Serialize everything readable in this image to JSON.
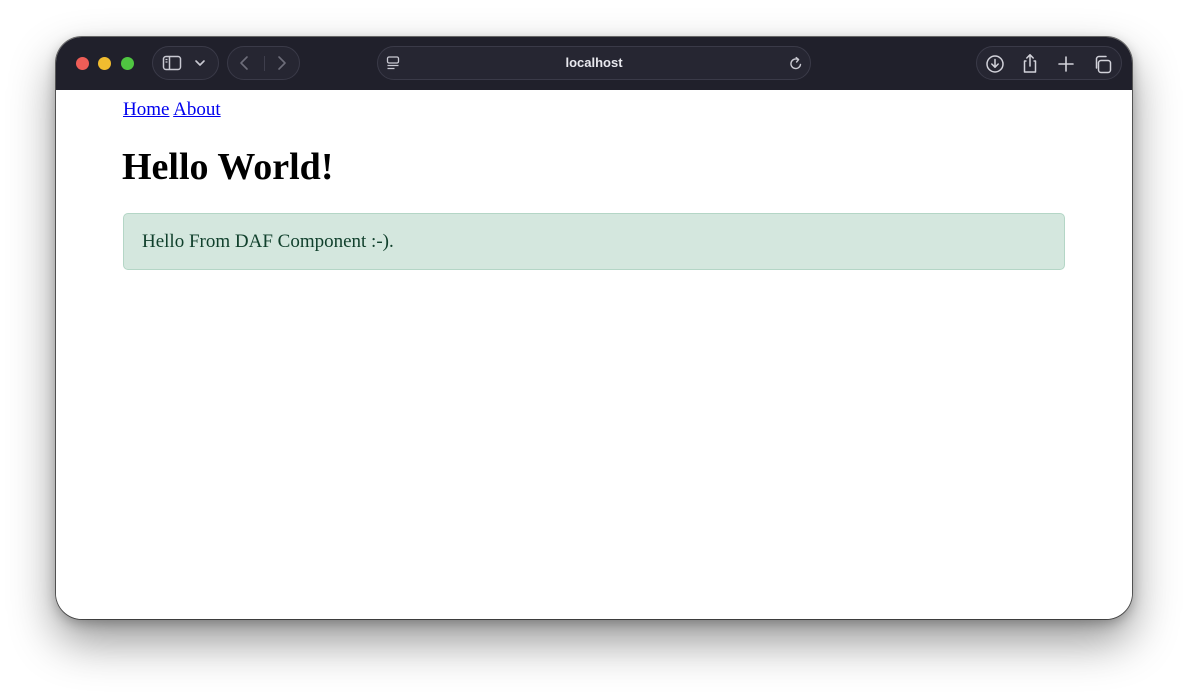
{
  "browser": {
    "address": "localhost",
    "icons": {
      "sidebar": "sidebar-icon",
      "tab_menu": "chevron-down-icon",
      "back": "chevron-left-icon",
      "forward": "chevron-right-icon",
      "page_menu": "page-menu-icon",
      "reload": "reload-icon",
      "downloads": "download-icon",
      "share": "share-icon",
      "new_tab": "plus-icon",
      "tab_overview": "tabs-icon"
    },
    "colors": {
      "toolbar": "#20202b",
      "close": "#ee5d57",
      "minimize": "#f1bc2f",
      "maximize": "#4fc641"
    }
  },
  "page": {
    "nav": {
      "home_label": "Home",
      "about_label": "About"
    },
    "heading": "Hello World!",
    "alert_text": "Hello From DAF Component :-).",
    "colors": {
      "link": "#0000ee",
      "alert_background": "#d4e7de",
      "alert_border": "#b4d6c6",
      "alert_text": "#10402c"
    }
  }
}
